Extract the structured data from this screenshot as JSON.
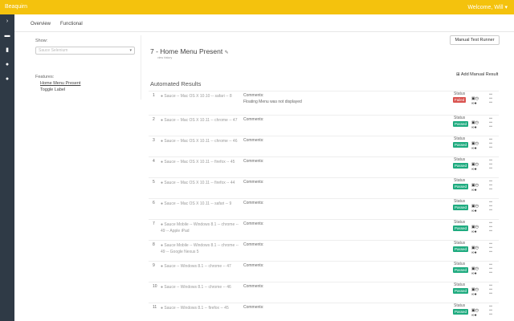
{
  "app": {
    "brand": "Beaquirn",
    "welcome": "Welcome, Will ▾"
  },
  "colors": {
    "topbar": "#f4c20d",
    "sidenav": "#2f3a46",
    "passed": "#1eab7f",
    "failed": "#d9534f"
  },
  "sidenav": [
    "chevron-right-icon",
    "car-icon",
    "bar-chart-icon",
    "user-icon",
    "users-icon"
  ],
  "tabs": [
    "Overview",
    "Functional"
  ],
  "filter": {
    "label": "Show:",
    "placeholder": "Sauce Selenium"
  },
  "features": {
    "label": "Features:",
    "items": [
      "Home Menu Present",
      "Toggle Label"
    ]
  },
  "buttons": {
    "manual_runner": "Manual Test Runner",
    "add_manual": "Add Manual Result"
  },
  "scenario": {
    "title": "7 - Home Menu Present",
    "subtitle": "view history"
  },
  "section": {
    "automated_title": "Automated Results"
  },
  "rows": [
    {
      "num": "1",
      "env": "Sauce -- Mac OS X 10.10 -- safari -- 8",
      "comment_label": "Comments:",
      "comment": "Floating Menu was not displayed",
      "status_label": "Status",
      "status": "Failed"
    },
    {
      "num": "2",
      "env": "Sauce -- Mac OS X 10.11 -- chrome -- 47",
      "comment_label": "Comments:",
      "comment": "",
      "status_label": "Status",
      "status": "Passed"
    },
    {
      "num": "3",
      "env": "Sauce -- Mac OS X 10.11 -- chrome -- 46",
      "comment_label": "Comments:",
      "comment": "",
      "status_label": "Status",
      "status": "Passed"
    },
    {
      "num": "4",
      "env": "Sauce -- Mac OS X 10.11 -- firefox -- 45",
      "comment_label": "Comments:",
      "comment": "",
      "status_label": "Status",
      "status": "Passed"
    },
    {
      "num": "5",
      "env": "Sauce -- Mac OS X 10.11 -- firefox -- 44",
      "comment_label": "Comments:",
      "comment": "",
      "status_label": "Status",
      "status": "Passed"
    },
    {
      "num": "6",
      "env": "Sauce -- Mac OS X 10.11 -- safari -- 9",
      "comment_label": "Comments:",
      "comment": "",
      "status_label": "Status",
      "status": "Passed"
    },
    {
      "num": "7",
      "env": "Sauce Mobile -- Windows 8.1 -- chrome -- 49 -- Apple iPad",
      "comment_label": "Comments:",
      "comment": "",
      "status_label": "Status",
      "status": "Passed"
    },
    {
      "num": "8",
      "env": "Sauce Mobile -- Windows 8.1 -- chrome -- 49 -- Google Nexus 5",
      "comment_label": "Comments:",
      "comment": "",
      "status_label": "Status",
      "status": "Passed"
    },
    {
      "num": "9",
      "env": "Sauce -- Windows 8.1 -- chrome -- 47",
      "comment_label": "Comments:",
      "comment": "",
      "status_label": "Status",
      "status": "Passed"
    },
    {
      "num": "10",
      "env": "Sauce -- Windows 8.1 -- chrome -- 46",
      "comment_label": "Comments:",
      "comment": "",
      "status_label": "Status",
      "status": "Passed"
    },
    {
      "num": "11",
      "env": "Sauce -- Windows 8.1 -- firefox -- 45",
      "comment_label": "Comments:",
      "comment": "",
      "status_label": "Status",
      "status": "Passed"
    }
  ]
}
